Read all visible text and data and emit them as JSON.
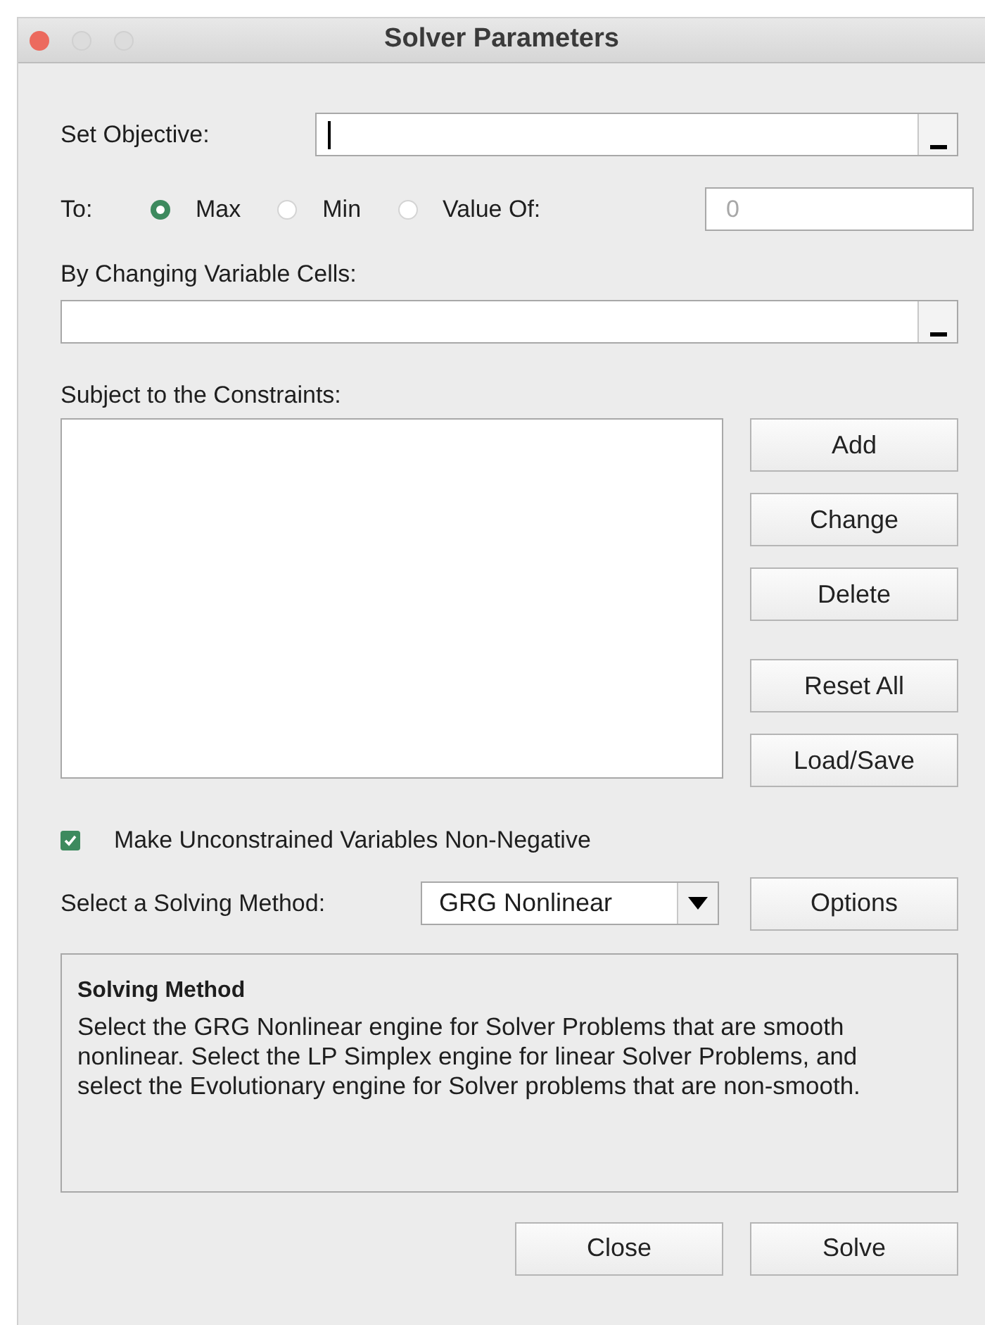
{
  "window": {
    "title": "Solver Parameters"
  },
  "objective": {
    "label": "Set Objective:"
  },
  "to": {
    "label": "To:",
    "options": [
      {
        "label": "Max",
        "selected": true
      },
      {
        "label": "Min",
        "selected": false
      },
      {
        "label": "Value Of:",
        "selected": false
      }
    ],
    "value_field": {
      "value": "0",
      "disabled": true
    }
  },
  "variable_cells": {
    "label": "By Changing Variable Cells:"
  },
  "constraints": {
    "label": "Subject to the Constraints:",
    "buttons": [
      "Add",
      "Change",
      "Delete",
      "Reset All",
      "Load/Save"
    ]
  },
  "non_negative": {
    "label": "Make Unconstrained Variables Non-Negative",
    "checked": true
  },
  "method": {
    "label": "Select a Solving Method:",
    "value": "GRG Nonlinear",
    "options_button": "Options"
  },
  "description": {
    "title": "Solving Method",
    "text": "Select the GRG Nonlinear engine for Solver Problems that are smooth nonlinear. Select the LP Simplex engine for linear Solver Problems, and select the Evolutionary engine for Solver problems that are non-smooth."
  },
  "footer_buttons": [
    "Close",
    "Solve"
  ]
}
